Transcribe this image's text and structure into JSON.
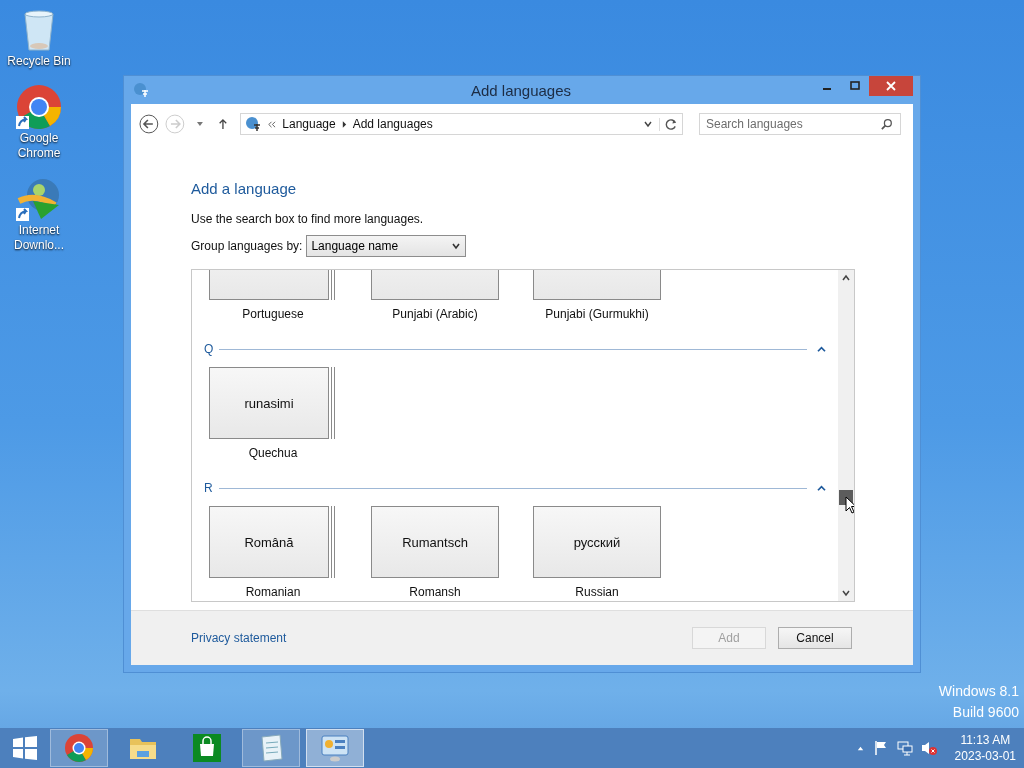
{
  "desktop_icons": [
    {
      "kind": "recycle",
      "label": "Recycle Bin",
      "shortcut": false
    },
    {
      "kind": "chrome",
      "label": "Google Chrome",
      "shortcut": true
    },
    {
      "kind": "download",
      "label": "Internet Downlo...",
      "shortcut": true
    }
  ],
  "window": {
    "title": "Add languages",
    "breadcrumb": [
      "Language",
      "Add languages"
    ],
    "search": {
      "placeholder": "Search languages"
    },
    "heading": "Add a language",
    "hint": "Use the search box to find more languages.",
    "group_by": {
      "label": "Group languages by:",
      "value": "Language name"
    },
    "groups": [
      {
        "tiles": [
          {
            "name": "Portuguese",
            "stacked": true
          },
          {
            "name": "Punjabi (Arabic)",
            "stacked": false
          },
          {
            "name": "Punjabi (Gurmukhi)",
            "stacked": false
          }
        ]
      },
      {
        "letter": "Q",
        "tiles": [
          {
            "native": "runasimi",
            "name": "Quechua",
            "stacked": true
          }
        ]
      },
      {
        "letter": "R",
        "tiles": [
          {
            "native": "Română",
            "name": "Romanian",
            "stacked": true
          },
          {
            "native": "Rumantsch",
            "name": "Romansh",
            "stacked": false
          },
          {
            "native": "русский",
            "name": "Russian",
            "stacked": false
          }
        ]
      }
    ],
    "privacy_link": "Privacy statement",
    "buttons": [
      {
        "label": "Add",
        "disabled": true
      },
      {
        "label": "Cancel",
        "disabled": false
      }
    ]
  },
  "os_version": [
    "Windows 8.1",
    "Build 9600"
  ],
  "taskbar": {
    "apps": [
      {
        "kind": "chrome",
        "running": true,
        "selected": false
      },
      {
        "kind": "explorer",
        "running": false,
        "selected": false
      },
      {
        "kind": "store",
        "running": false,
        "selected": false
      },
      {
        "kind": "notepad",
        "running": true,
        "selected": false
      },
      {
        "kind": "control",
        "running": true,
        "selected": true
      }
    ],
    "time": "11:13 AM",
    "date": "2023-03-01"
  }
}
